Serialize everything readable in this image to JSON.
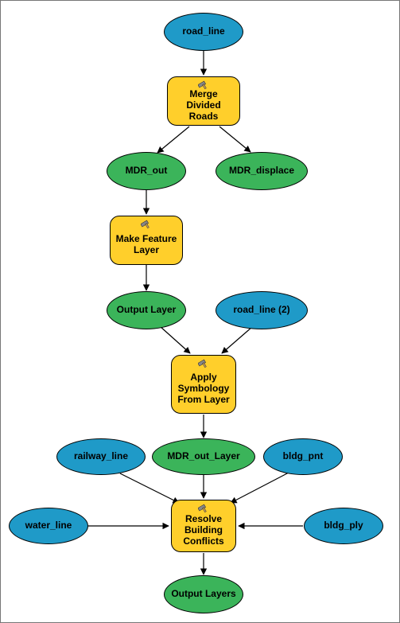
{
  "diagram": {
    "type": "modelbuilder-flowchart",
    "inputs": {
      "road_line": "road_line",
      "road_line_2": "road_line (2)",
      "railway_line": "railway_line",
      "water_line": "water_line",
      "bldg_pnt": "bldg_pnt",
      "bldg_ply": "bldg_ply"
    },
    "tools": {
      "merge_divided_roads": "Merge Divided Roads",
      "make_feature_layer": "Make Feature Layer",
      "apply_symbology": "Apply Symbology From Layer",
      "resolve_building_conflicts": "Resolve Building Conflicts"
    },
    "outputs": {
      "mdr_out": "MDR_out",
      "mdr_displace": "MDR_displace",
      "output_layer": "Output Layer",
      "mdr_out_layer": "MDR_out_Layer",
      "output_layers": "Output Layers"
    },
    "colors": {
      "input": "#1f9ac8",
      "output": "#3bb45a",
      "tool": "#ffcf2b"
    },
    "edges": [
      [
        "road_line",
        "merge_divided_roads"
      ],
      [
        "merge_divided_roads",
        "mdr_out"
      ],
      [
        "merge_divided_roads",
        "mdr_displace"
      ],
      [
        "mdr_out",
        "make_feature_layer"
      ],
      [
        "make_feature_layer",
        "output_layer"
      ],
      [
        "output_layer",
        "apply_symbology"
      ],
      [
        "road_line_2",
        "apply_symbology"
      ],
      [
        "apply_symbology",
        "mdr_out_layer"
      ],
      [
        "mdr_out_layer",
        "resolve_building_conflicts"
      ],
      [
        "railway_line",
        "resolve_building_conflicts"
      ],
      [
        "water_line",
        "resolve_building_conflicts"
      ],
      [
        "bldg_pnt",
        "resolve_building_conflicts"
      ],
      [
        "bldg_ply",
        "resolve_building_conflicts"
      ],
      [
        "resolve_building_conflicts",
        "output_layers"
      ]
    ]
  }
}
